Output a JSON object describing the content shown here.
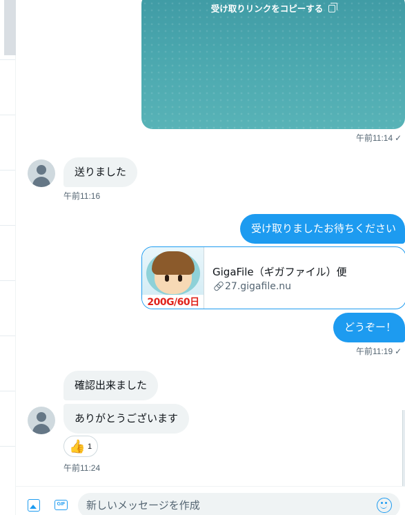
{
  "media_card": {
    "copy_link_label": "受け取りリンクをコピーする",
    "icon": "copy-icon"
  },
  "messages": [
    {
      "id": "m1",
      "direction": "outgoing",
      "timestamp": "午前11:14",
      "read_mark": "✓"
    },
    {
      "id": "m2",
      "direction": "incoming",
      "text": "送りました",
      "timestamp": "午前11:16"
    },
    {
      "id": "m3",
      "direction": "outgoing",
      "text": "受け取りましたお待ちください"
    },
    {
      "id": "m4",
      "direction": "outgoing",
      "link_preview": {
        "title": "GigaFile（ギガファイル）便",
        "domain": "27.gigafile.nu",
        "thumb_banner": "200G/60日"
      }
    },
    {
      "id": "m5",
      "direction": "outgoing",
      "text": "どうぞー！",
      "timestamp": "午前11:19",
      "read_mark": "✓"
    },
    {
      "id": "m6",
      "direction": "incoming",
      "text": "確認出来ました"
    },
    {
      "id": "m7",
      "direction": "incoming",
      "text": "ありがとうございます",
      "reaction": {
        "emoji": "👍",
        "count": "1"
      },
      "timestamp": "午前11:24"
    }
  ],
  "composer": {
    "placeholder": "新しいメッセージを作成",
    "gif_label": "GIF"
  },
  "colors": {
    "accent": "#1d9bf0",
    "incoming_bubble": "#eff3f4",
    "media_card": "#4aa7ae"
  }
}
